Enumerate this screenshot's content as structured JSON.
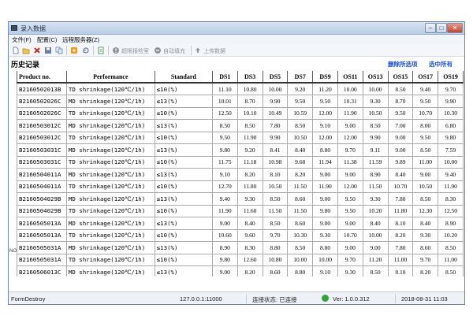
{
  "window": {
    "title": "录入数据",
    "controls": {
      "min": "–",
      "max": "□",
      "close": "✕"
    }
  },
  "menu": [
    "文件(F)",
    "配置(C)",
    "远程服务器(Z)"
  ],
  "toolbar": {
    "icons": [
      "new-file-icon",
      "open-folder-icon",
      "delete-icon",
      "save-icon",
      "copy-icon",
      "export-icon",
      "refresh-icon",
      "document-icon"
    ],
    "buttons": [
      {
        "label": "超限报检室",
        "icon": "alert-icon"
      },
      {
        "label": "自动填充",
        "icon": "autofill-icon"
      },
      {
        "label": "上传数据",
        "icon": "upload-icon"
      }
    ]
  },
  "history": {
    "title": "历史记录",
    "links": {
      "delete_selected": "删除所选项",
      "select_all": "选中所有"
    }
  },
  "table": {
    "columns": [
      "Product no.",
      "Performance",
      "Standard",
      "DS1",
      "DS3",
      "DS5",
      "DS7",
      "DS9",
      "OS11",
      "OS13",
      "OS15",
      "OS17",
      "OS19"
    ],
    "rows": [
      [
        "B2160502013B",
        "TD shrinkage(120℃/1h)",
        "≤10(%)",
        "11.10",
        "10.80",
        "10.00",
        "9.20",
        "11.20",
        "10.00",
        "10.00",
        "8.50",
        "9.40",
        "9.70"
      ],
      [
        "B2160502026C",
        "MD shrinkage(120℃/1h)",
        "≤13(%)",
        "10.01",
        "8.70",
        "9.90",
        "9.50",
        "9.50",
        "10.31",
        "9.30",
        "8.70",
        "9.50",
        "9.90"
      ],
      [
        "B2160502026C",
        "TD shrinkage(120℃/1h)",
        "≤10(%)",
        "12.50",
        "10.10",
        "10.49",
        "10.59",
        "12.00",
        "11.90",
        "10.50",
        "9.50",
        "10.70",
        "10.30"
      ],
      [
        "B2160503012C",
        "MD shrinkage(120℃/1h)",
        "≤13(%)",
        "8.50",
        "8.50",
        "7.80",
        "8.50",
        "9.10",
        "9.00",
        "8.50",
        "7.00",
        "8.00",
        "6.80"
      ],
      [
        "B2160503012C",
        "TD shrinkage(120℃/1h)",
        "≤10(%)",
        "9.50",
        "11.90",
        "9.90",
        "10.50",
        "12.00",
        "12.00",
        "9.90",
        "9.00",
        "9.50",
        "9.80"
      ],
      [
        "B2160503031C",
        "MD shrinkage(120℃/1h)",
        "≤13(%)",
        "9.80",
        "9.20",
        "8.41",
        "8.40",
        "8.80",
        "9.70",
        "9.11",
        "9.00",
        "8.50",
        "7.59"
      ],
      [
        "B2160503031C",
        "TD shrinkage(120℃/1h)",
        "≤10(%)",
        "11.75",
        "11.18",
        "10.98",
        "9.68",
        "11.94",
        "11.38",
        "11.59",
        "9.89",
        "11.00",
        "10.00"
      ],
      [
        "B2160504011A",
        "MD shrinkage(120℃/1h)",
        "≤13(%)",
        "9.10",
        "8.20",
        "8.10",
        "8.20",
        "9.00",
        "9.00",
        "8.90",
        "8.40",
        "9.00",
        "9.40"
      ],
      [
        "B2160504011A",
        "TD shrinkage(120℃/1h)",
        "≤10(%)",
        "12.70",
        "11.80",
        "10.50",
        "11.50",
        "11.90",
        "12.00",
        "11.50",
        "10.70",
        "10.50",
        "11.90"
      ],
      [
        "B2160504029B",
        "MD shrinkage(120℃/1h)",
        "≤13(%)",
        "9.40",
        "9.30",
        "8.50",
        "8.60",
        "9.00",
        "9.50",
        "9.30",
        "7.80",
        "8.50",
        "8.30"
      ],
      [
        "B2160504029B",
        "TD shrinkage(120℃/1h)",
        "≤10(%)",
        "11.90",
        "11.60",
        "11.50",
        "11.50",
        "9.80",
        "9.50",
        "10.20",
        "11.80",
        "12.30",
        "12.50"
      ],
      [
        "B2160505013A",
        "MD shrinkage(120℃/1h)",
        "≤13(%)",
        "9.00",
        "8.40",
        "8.50",
        "8.60",
        "9.00",
        "9.00",
        "8.40",
        "8.10",
        "8.40",
        "8.90"
      ],
      [
        "B2160505013A",
        "TD shrinkage(120℃/1h)",
        "≤10(%)",
        "10.60",
        "9.60",
        "9.70",
        "10.30",
        "9.30",
        "10.70",
        "10.00",
        "8.20",
        "9.30",
        "10.20"
      ],
      [
        "B2160505031A",
        "MD shrinkage(120℃/1h)",
        "≤13(%)",
        "8.90",
        "8.30",
        "8.80",
        "8.50",
        "8.80",
        "9.00",
        "9.00",
        "7.80",
        "8.60",
        "8.50"
      ],
      [
        "B2160505031A",
        "TD shrinkage(120℃/1h)",
        "≤10(%)",
        "9.80",
        "12.60",
        "10.80",
        "10.00",
        "10.00",
        "9.70",
        "11.20",
        "11.00",
        "9.70",
        "11.00"
      ],
      [
        "B2160506013C",
        "MD shrinkage(120℃/1h)",
        "≤13(%)",
        "9.00",
        "8.20",
        "8.60",
        "8.80",
        "9.10",
        "9.30",
        "8.50",
        "8.10",
        "8.20",
        "8.50"
      ]
    ]
  },
  "side_label": "NO",
  "status": {
    "left": "FormDestroy",
    "server": "127.0.0.1:11000",
    "connection": "连接状态: 已连接",
    "version": "Ver: 1.0.0.312",
    "datetime": "2018-08-31 11:03"
  }
}
